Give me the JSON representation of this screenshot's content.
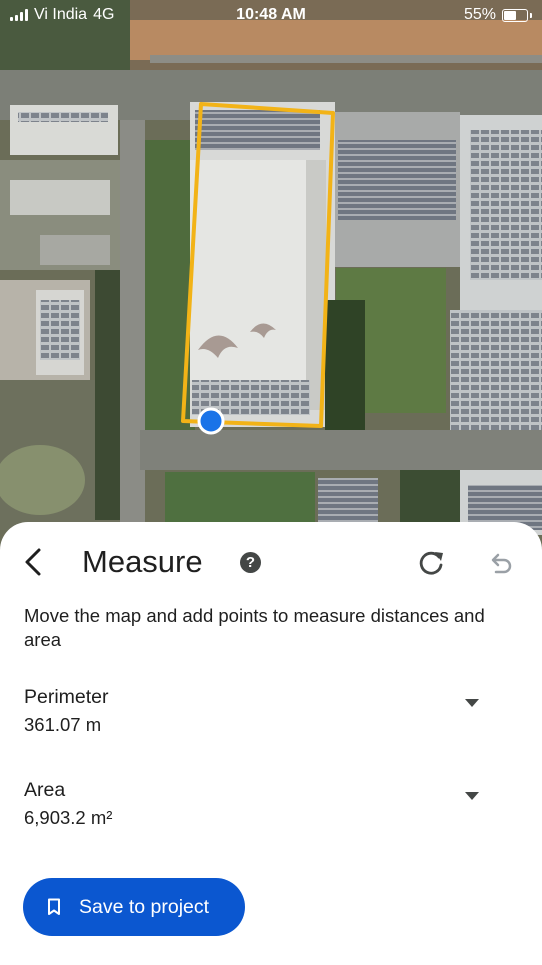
{
  "status_bar": {
    "carrier": "Vi India",
    "network": "4G",
    "time": "10:48 AM",
    "battery": "55%",
    "battery_level": 0.55
  },
  "map": {
    "outline_color": "#f2b317",
    "location_dot_color": "#1a73e8"
  },
  "sheet": {
    "title": "Measure",
    "help_icon": "?",
    "instructions": "Move the map and add points to measure distances and area",
    "perimeter": {
      "label": "Perimeter",
      "value": "361.07 m"
    },
    "area": {
      "label": "Area",
      "value": "6,903.2 m²"
    },
    "save_button_label": "Save to project",
    "accent_color": "#0b57d0"
  }
}
